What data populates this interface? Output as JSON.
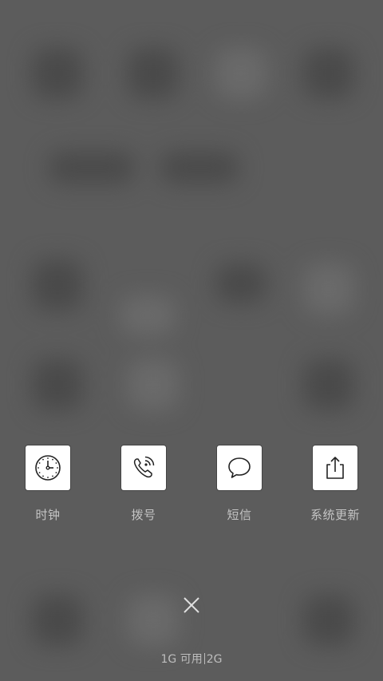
{
  "apps": [
    {
      "label": "时钟",
      "icon": "clock-icon"
    },
    {
      "label": "拨号",
      "icon": "phone-icon"
    },
    {
      "label": "短信",
      "icon": "message-bubble-icon"
    },
    {
      "label": "系统更新",
      "icon": "share-upload-icon"
    }
  ],
  "close": {
    "icon": "close-icon"
  },
  "memory": {
    "available": "1G 可用",
    "total": "2G"
  },
  "colors": {
    "background": "#5c5c5c",
    "tile": "#ffffff",
    "label": "#c4c4c4"
  }
}
